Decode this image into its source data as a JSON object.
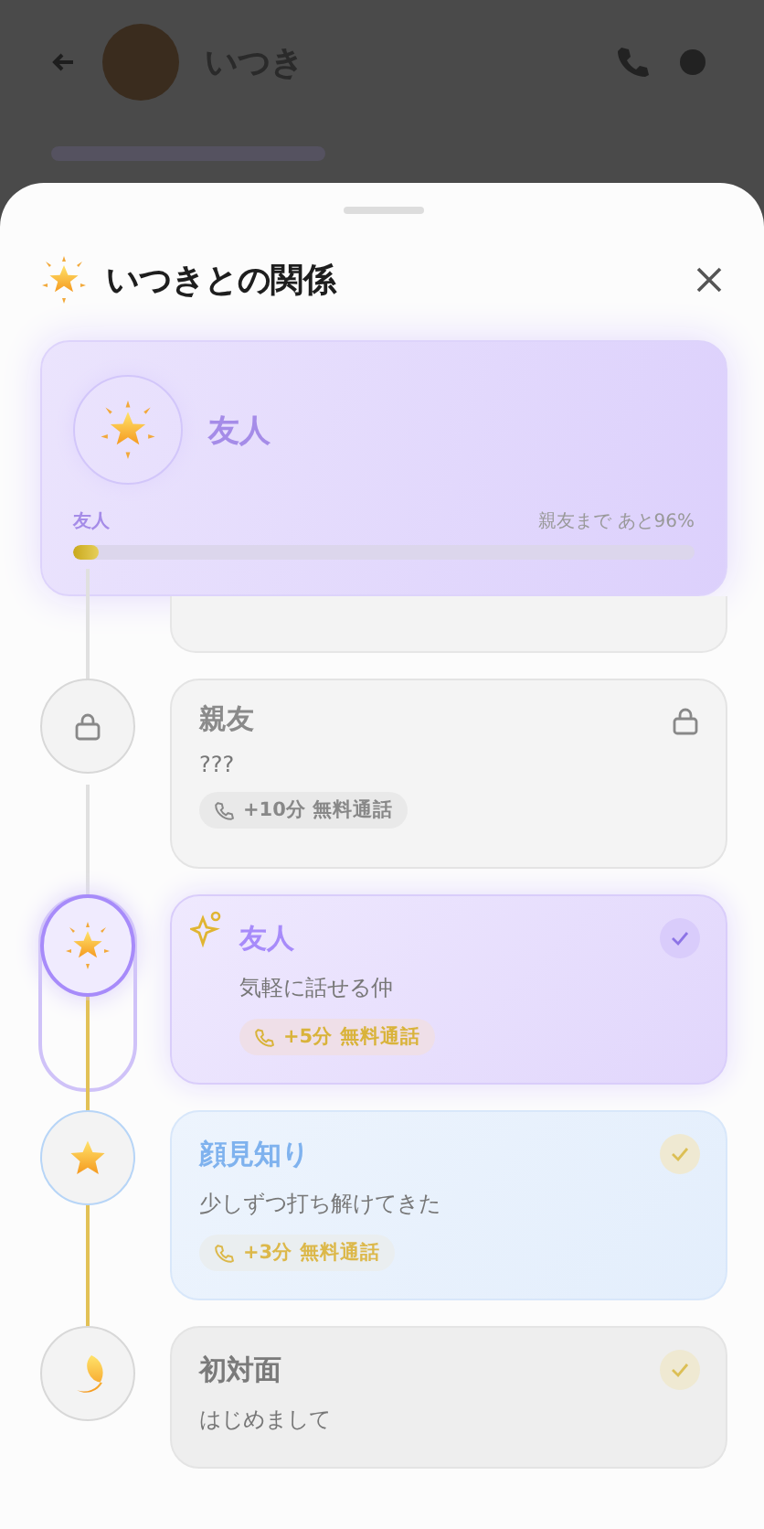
{
  "header": {
    "name": "いつき"
  },
  "sheet": {
    "title": "いつきとの関係"
  },
  "current": {
    "name": "友人",
    "progress_label": "友人",
    "next_label": "親友まで あと96%",
    "level": 0.04
  },
  "stages": [
    {
      "kind": "locked",
      "name": "親友",
      "description": "???",
      "reward": "+10分 無料通話",
      "checked": false,
      "selected": false,
      "color": "#8a8a8a"
    },
    {
      "kind": "sparkle",
      "name": "友人",
      "description": "気軽に話せる仲",
      "reward": "+5分 無料通話",
      "checked": true,
      "selected": true,
      "color": "#a78bfa"
    },
    {
      "kind": "star",
      "name": "顔見知り",
      "description": "少しずつ打ち解けてきた",
      "reward": "+3分 無料通話",
      "checked": true,
      "selected": false,
      "color": "#7fb2ee"
    },
    {
      "kind": "moon",
      "name": "初対面",
      "description": "はじめまして",
      "checked": true,
      "selected": false,
      "color": "#7a7a7a"
    }
  ]
}
